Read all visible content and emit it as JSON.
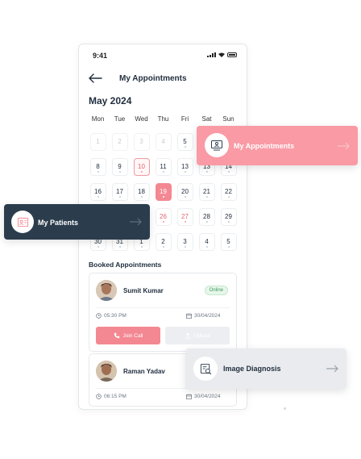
{
  "status_bar": {
    "time": "9:41"
  },
  "header": {
    "title": "My Appointments"
  },
  "calendar": {
    "month_label": "May 2024",
    "weekdays": [
      "Mon",
      "Tue",
      "Wed",
      "Thu",
      "Fri",
      "Sat",
      "Sun"
    ],
    "rows": [
      [
        "1",
        "2",
        "3",
        "4",
        "5",
        "6",
        "7"
      ],
      [
        "8",
        "9",
        "10",
        "11",
        "13",
        "13",
        "14"
      ],
      [
        "16",
        "17",
        "18",
        "19",
        "20",
        "21",
        "22"
      ],
      [
        "23",
        "24",
        "25",
        "26",
        "27",
        "28",
        "29"
      ],
      [
        "30",
        "31",
        "1",
        "2",
        "3",
        "4",
        "5"
      ]
    ]
  },
  "booked": {
    "title": "Booked Appointments",
    "appointments": [
      {
        "name": "Sumit Kumar",
        "status": "Online",
        "time": "05:30 PM",
        "date": "30/04/2024",
        "join_label": "Join Call",
        "upload_label": "Upload"
      },
      {
        "name": "Raman Yadav",
        "time": "06:15 PM",
        "date": "30/04/2024"
      }
    ]
  },
  "feature_cards": {
    "appointments": "My Appointments",
    "patients": "My Patients",
    "diagnosis": "Image Diagnosis"
  },
  "colors": {
    "accent": "#f48892",
    "dark": "#2b3d4d",
    "light": "#e9ebee"
  }
}
